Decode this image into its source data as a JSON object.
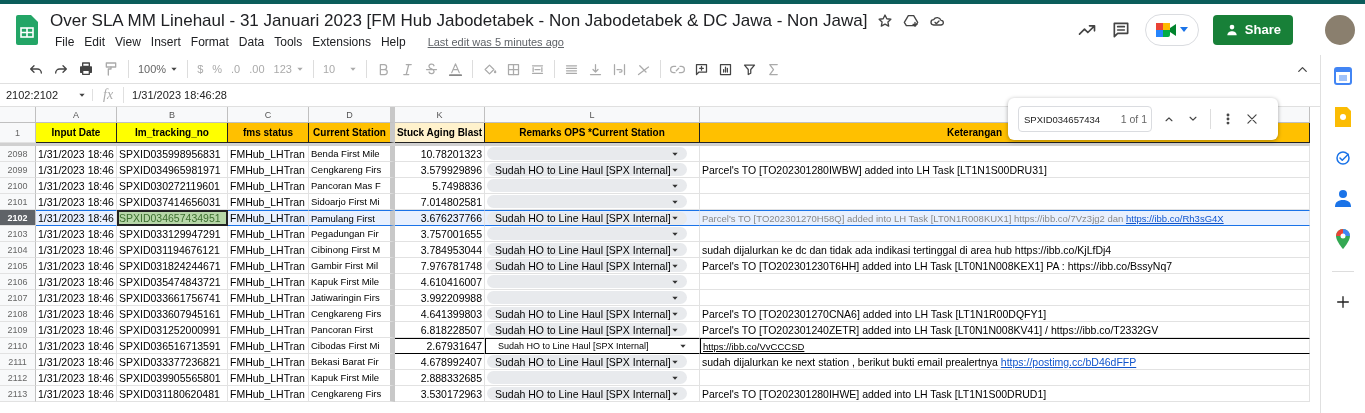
{
  "document": {
    "title": "Over SLA MM Linehaul - 31 Januari 2023 [FM Hub Jabodetabek - Non Jabodetabek & DC Jawa - Non Jawa]",
    "last_edit": "Last edit was 5 minutes ago"
  },
  "menu": [
    "File",
    "Edit",
    "View",
    "Insert",
    "Format",
    "Data",
    "Tools",
    "Extensions",
    "Help"
  ],
  "share_button": "Share",
  "toolbar": {
    "zoom": "100%",
    "currency": "$",
    "percent": "%",
    "decrease_decimals": ".0",
    "increase_decimals": ".00",
    "number_format": "123",
    "font_size": "10"
  },
  "formula_bar": {
    "name_box": "2102:2102",
    "fx_label": "fx",
    "formula": "1/31/2023 18:46:28"
  },
  "find_bar": {
    "value": "SPXID034657434",
    "count": "1 of 1"
  },
  "sheet": {
    "column_letters": [
      "A",
      "B",
      "C",
      "D",
      "K",
      "L"
    ],
    "headers": [
      {
        "label": "Input Date",
        "color": "#ffff00"
      },
      {
        "label": "Im_tracking_no",
        "color": "#ffff00"
      },
      {
        "label": "fms status",
        "color": "#ffc000"
      },
      {
        "label": "Current Station",
        "color": "#ffc000"
      },
      {
        "label": "Stuck Aging Blast",
        "color": "#fff2cc"
      },
      {
        "label": "Remarks OPS *Current Station",
        "color": "#ffc000"
      },
      {
        "label": "Keterangan",
        "color": "#ffc000"
      }
    ],
    "header_row_number": "1",
    "rows": [
      {
        "number": "2098",
        "date": "1/31/2023 18:46",
        "tracking": "SPXID035998956831",
        "status": "FMHub_LHTran",
        "station": "Benda First Mile",
        "aging": "10.78201323",
        "remark": {
          "kind": "chip"
        },
        "selected": false
      },
      {
        "number": "2099",
        "date": "1/31/2023 18:46",
        "tracking": "SPXID034965981971",
        "status": "FMHub_LHTran",
        "station": "Cengkareng Firs",
        "aging": "3.579929896",
        "remark": {
          "kind": "chip",
          "label": "Sudah HO to Line Haul [SPX Internal]"
        },
        "note": "Parcel's TO [TO202301280IWBW] added into LH Task [LT1N1S00DRU31]",
        "selected": false
      },
      {
        "number": "2100",
        "date": "1/31/2023 18:46",
        "tracking": "SPXID030272119601",
        "status": "FMHub_LHTran",
        "station": "Pancoran Mas F",
        "aging": "5.7498836",
        "remark": {
          "kind": "chip"
        },
        "selected": false
      },
      {
        "number": "2101",
        "date": "1/31/2023 18:46",
        "tracking": "SPXID037414656031",
        "status": "FMHub_LHTran",
        "station": "Sidoarjo First Mi",
        "aging": "7.014802581",
        "remark": {
          "kind": "chip"
        },
        "selected": false
      },
      {
        "number": "2102",
        "date": "1/31/2023 18:46",
        "tracking": "SPXID034657434951",
        "status": "FMHub_LHTran",
        "station": "Pamulang First",
        "aging": "3.676237766",
        "remark": {
          "kind": "chip",
          "label": "Sudah HO to Line Haul [SPX Internal]"
        },
        "note": "Parcel's TO [TO202301270H58Q] added into LH Task [LT0N1R008KUX1] https://ibb.co/7Vz3jg2 dan",
        "note_link": "https://ibb.co/Rh3sG4X",
        "note_muted": true,
        "selected": true
      },
      {
        "number": "2103",
        "date": "1/31/2023 18:46",
        "tracking": "SPXID033129947291",
        "status": "FMHub_LHTran",
        "station": "Pegadungan Fir",
        "aging": "3.757001655",
        "remark": {
          "kind": "chip"
        },
        "selected": false
      },
      {
        "number": "2104",
        "date": "1/31/2023 18:46",
        "tracking": "SPXID031194676121",
        "status": "FMHub_LHTran",
        "station": "Cibinong First M",
        "aging": "3.784953044",
        "remark": {
          "kind": "chip",
          "label": "Sudah HO to Line Haul [SPX Internal]"
        },
        "note": "sudah dijalurkan ke dc dan tidak ada indikasi tertinggal di area hub https://ibb.co/KjLfDj4",
        "selected": false
      },
      {
        "number": "2105",
        "date": "1/31/2023 18:46",
        "tracking": "SPXID031824244671",
        "status": "FMHub_LHTran",
        "station": "Gambir First Mil",
        "aging": "7.976781748",
        "remark": {
          "kind": "chip",
          "label": "Sudah HO to Line Haul [SPX Internal]"
        },
        "note": "Parcel's TO [TO202301230T6HH] added into LH Task [LT0N1N008KEX1] PA : https://ibb.co/BssyNq7",
        "selected": false
      },
      {
        "number": "2106",
        "date": "1/31/2023 18:46",
        "tracking": "SPXID035474843721",
        "status": "FMHub_LHTran",
        "station": "Kapuk First Mile",
        "aging": "4.610416007",
        "remark": {
          "kind": "chip"
        },
        "selected": false
      },
      {
        "number": "2107",
        "date": "1/31/2023 18:46",
        "tracking": "SPXID033661756741",
        "status": "FMHub_LHTran",
        "station": "Jatiwaringin Firs",
        "aging": "3.992209988",
        "remark": {
          "kind": "chip"
        },
        "selected": false
      },
      {
        "number": "2108",
        "date": "1/31/2023 18:46",
        "tracking": "SPXID033607945161",
        "status": "FMHub_LHTran",
        "station": "Cengkareng Firs",
        "aging": "4.641399803",
        "remark": {
          "kind": "chip",
          "label": "Sudah HO to Line Haul [SPX Internal]"
        },
        "note": "Parcel's TO [TO202301270CNA6] added into LH Task [LT1N1R00DQFY1]",
        "selected": false
      },
      {
        "number": "2109",
        "date": "1/31/2023 18:46",
        "tracking": "SPXID031252000991",
        "status": "FMHub_LHTran",
        "station": "Pancoran First",
        "aging": "6.818228507",
        "remark": {
          "kind": "chip",
          "label": "Sudah HO to Line Haul [SPX Internal]"
        },
        "note": "Parcel's TO [TO202301240ZETR] added into LH Task [LT0N1N008KV41] / https://ibb.co/T2332GV",
        "selected": false
      },
      {
        "number": "2110",
        "date": "1/31/2023 18:46",
        "tracking": "SPXID036516713591",
        "status": "FMHub_LHTran",
        "station": "Cibodas First Mi",
        "aging": "2.67931647",
        "remark": {
          "kind": "boxed",
          "label": "Sudah HO to Line Haul [SPX Internal]"
        },
        "note_link": "https://ibb.co/VvCCCSD",
        "selected": false
      },
      {
        "number": "2111",
        "date": "1/31/2023 18:46",
        "tracking": "SPXID033377236821",
        "status": "FMHub_LHTran",
        "station": "Bekasi Barat Fir",
        "aging": "4.678992407",
        "remark": {
          "kind": "chip",
          "label": "Sudah HO to Line Haul [SPX Internal]"
        },
        "note": "sudah dijalurkan ke next station , berikut bukti email prealertnya",
        "note_link": "https://postimg.cc/bD46dFFP",
        "selected": false
      },
      {
        "number": "2112",
        "date": "1/31/2023 18:46",
        "tracking": "SPXID039905565801",
        "status": "FMHub_LHTran",
        "station": "Kapuk First Mile",
        "aging": "2.888332685",
        "remark": {
          "kind": "chip"
        },
        "selected": false
      },
      {
        "number": "2113",
        "date": "1/31/2023 18:46",
        "tracking": "SPXID031180620481",
        "status": "FMHub_LHTran",
        "station": "Cengkareng Firs",
        "aging": "3.530172963",
        "remark": {
          "kind": "chip",
          "label": "Sudah HO to Line Haul [SPX Internal]"
        },
        "note": "Parcel's TO [TO202301280IHWE] added into LH Task [LT1N1S00DRUD1]",
        "selected": false
      }
    ]
  }
}
